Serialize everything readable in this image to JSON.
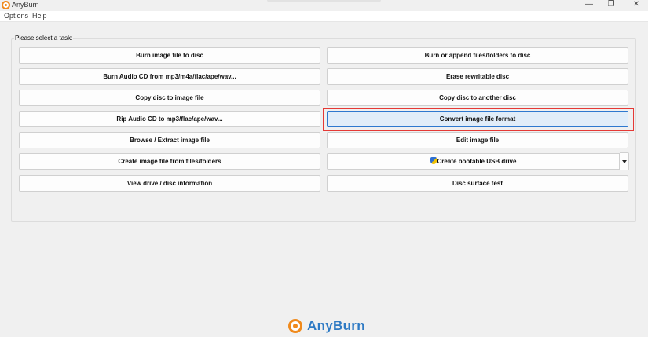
{
  "window": {
    "title": "AnyBurn",
    "minimize": "—",
    "restore": "❐",
    "close": "✕"
  },
  "menu": [
    "Options",
    "Help"
  ],
  "task_group": {
    "label": "Please select a task:"
  },
  "buttons_left": [
    "Burn image file to disc",
    "Burn Audio CD from mp3/m4a/flac/ape/wav...",
    "Copy disc to image file",
    "Rip Audio CD to mp3/flac/ape/wav...",
    "Browse / Extract image file",
    "Create image file from files/folders",
    "View drive / disc information"
  ],
  "buttons_right": [
    "Burn or append files/folders to disc",
    "Erase rewritable disc",
    "Copy disc to another disc",
    "Convert image file format",
    "Edit image file",
    "Create bootable USB drive",
    "Disc surface test"
  ],
  "selected_button": "Convert image file format",
  "brand": {
    "name": "AnyBurn"
  },
  "colors": {
    "brand_orange": "#f08a1c",
    "brand_blue": "#2e7ac4",
    "highlight_red": "#e53935",
    "selected_bg": "#e1edf9"
  }
}
